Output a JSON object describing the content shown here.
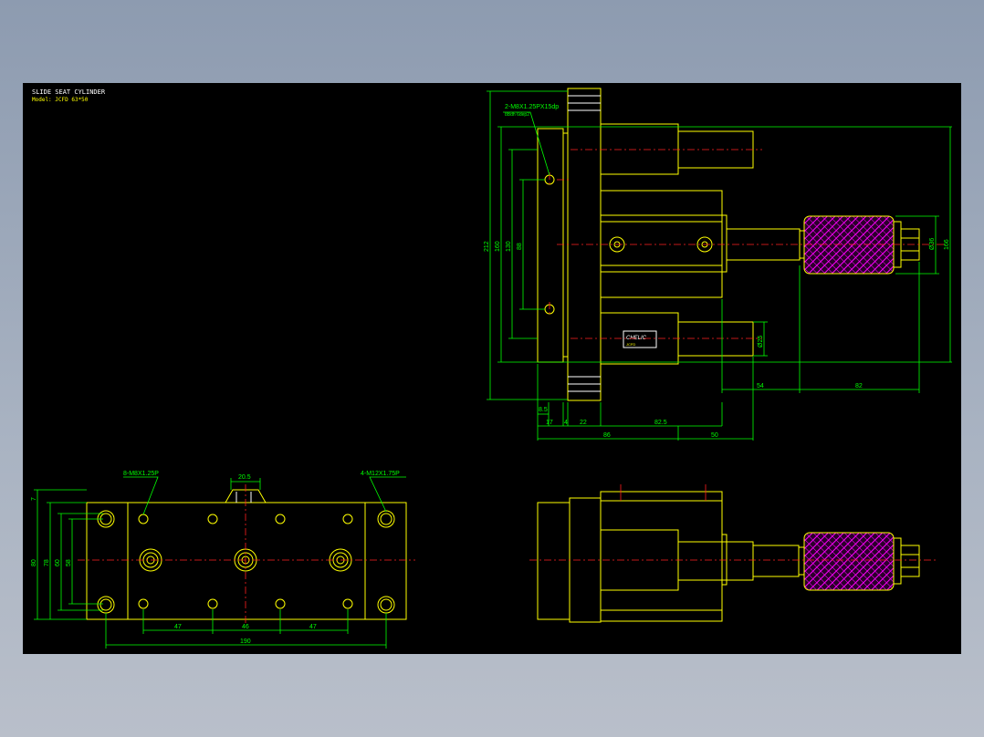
{
  "title": {
    "line1": "SLIDE SEAT CYLINDER",
    "line2": "Model: JCFD 63*50"
  },
  "colors": {
    "background": "#000000",
    "outline": "#ffff00",
    "dimension": "#00ff00",
    "centerline": "#ff2020",
    "hatch": "#ff00ff",
    "frame": "#8d9bb0"
  },
  "side_view": {
    "hole_note_1": "2-M8X1.25PX15dp",
    "hole_note_2": "8Bdh 6dep2",
    "nameplate": "CHELIC",
    "nameplate_sub": "JCFD",
    "dims_vertical": {
      "d212": "212",
      "d160": "160",
      "d130": "130",
      "d88": "88",
      "d36": "Ø36",
      "d166": "166",
      "d25": "Ø25"
    },
    "dims_horizontal": {
      "d8_5": "8.5",
      "d17": "17",
      "d4": "4",
      "d22": "22",
      "d82_5": "82.5",
      "d86": "86",
      "d50": "50",
      "d54": "54",
      "d82": "82"
    }
  },
  "top_view": {
    "note_left": "8-M8X1.25P",
    "note_right": "4-M12X1.75P",
    "dims": {
      "d20_5": "20.5",
      "d7": "7",
      "d80": "80",
      "d78": "78",
      "d60": "60",
      "d58": "58",
      "d47a": "47",
      "d46": "46",
      "d47b": "47",
      "d190": "190"
    }
  }
}
